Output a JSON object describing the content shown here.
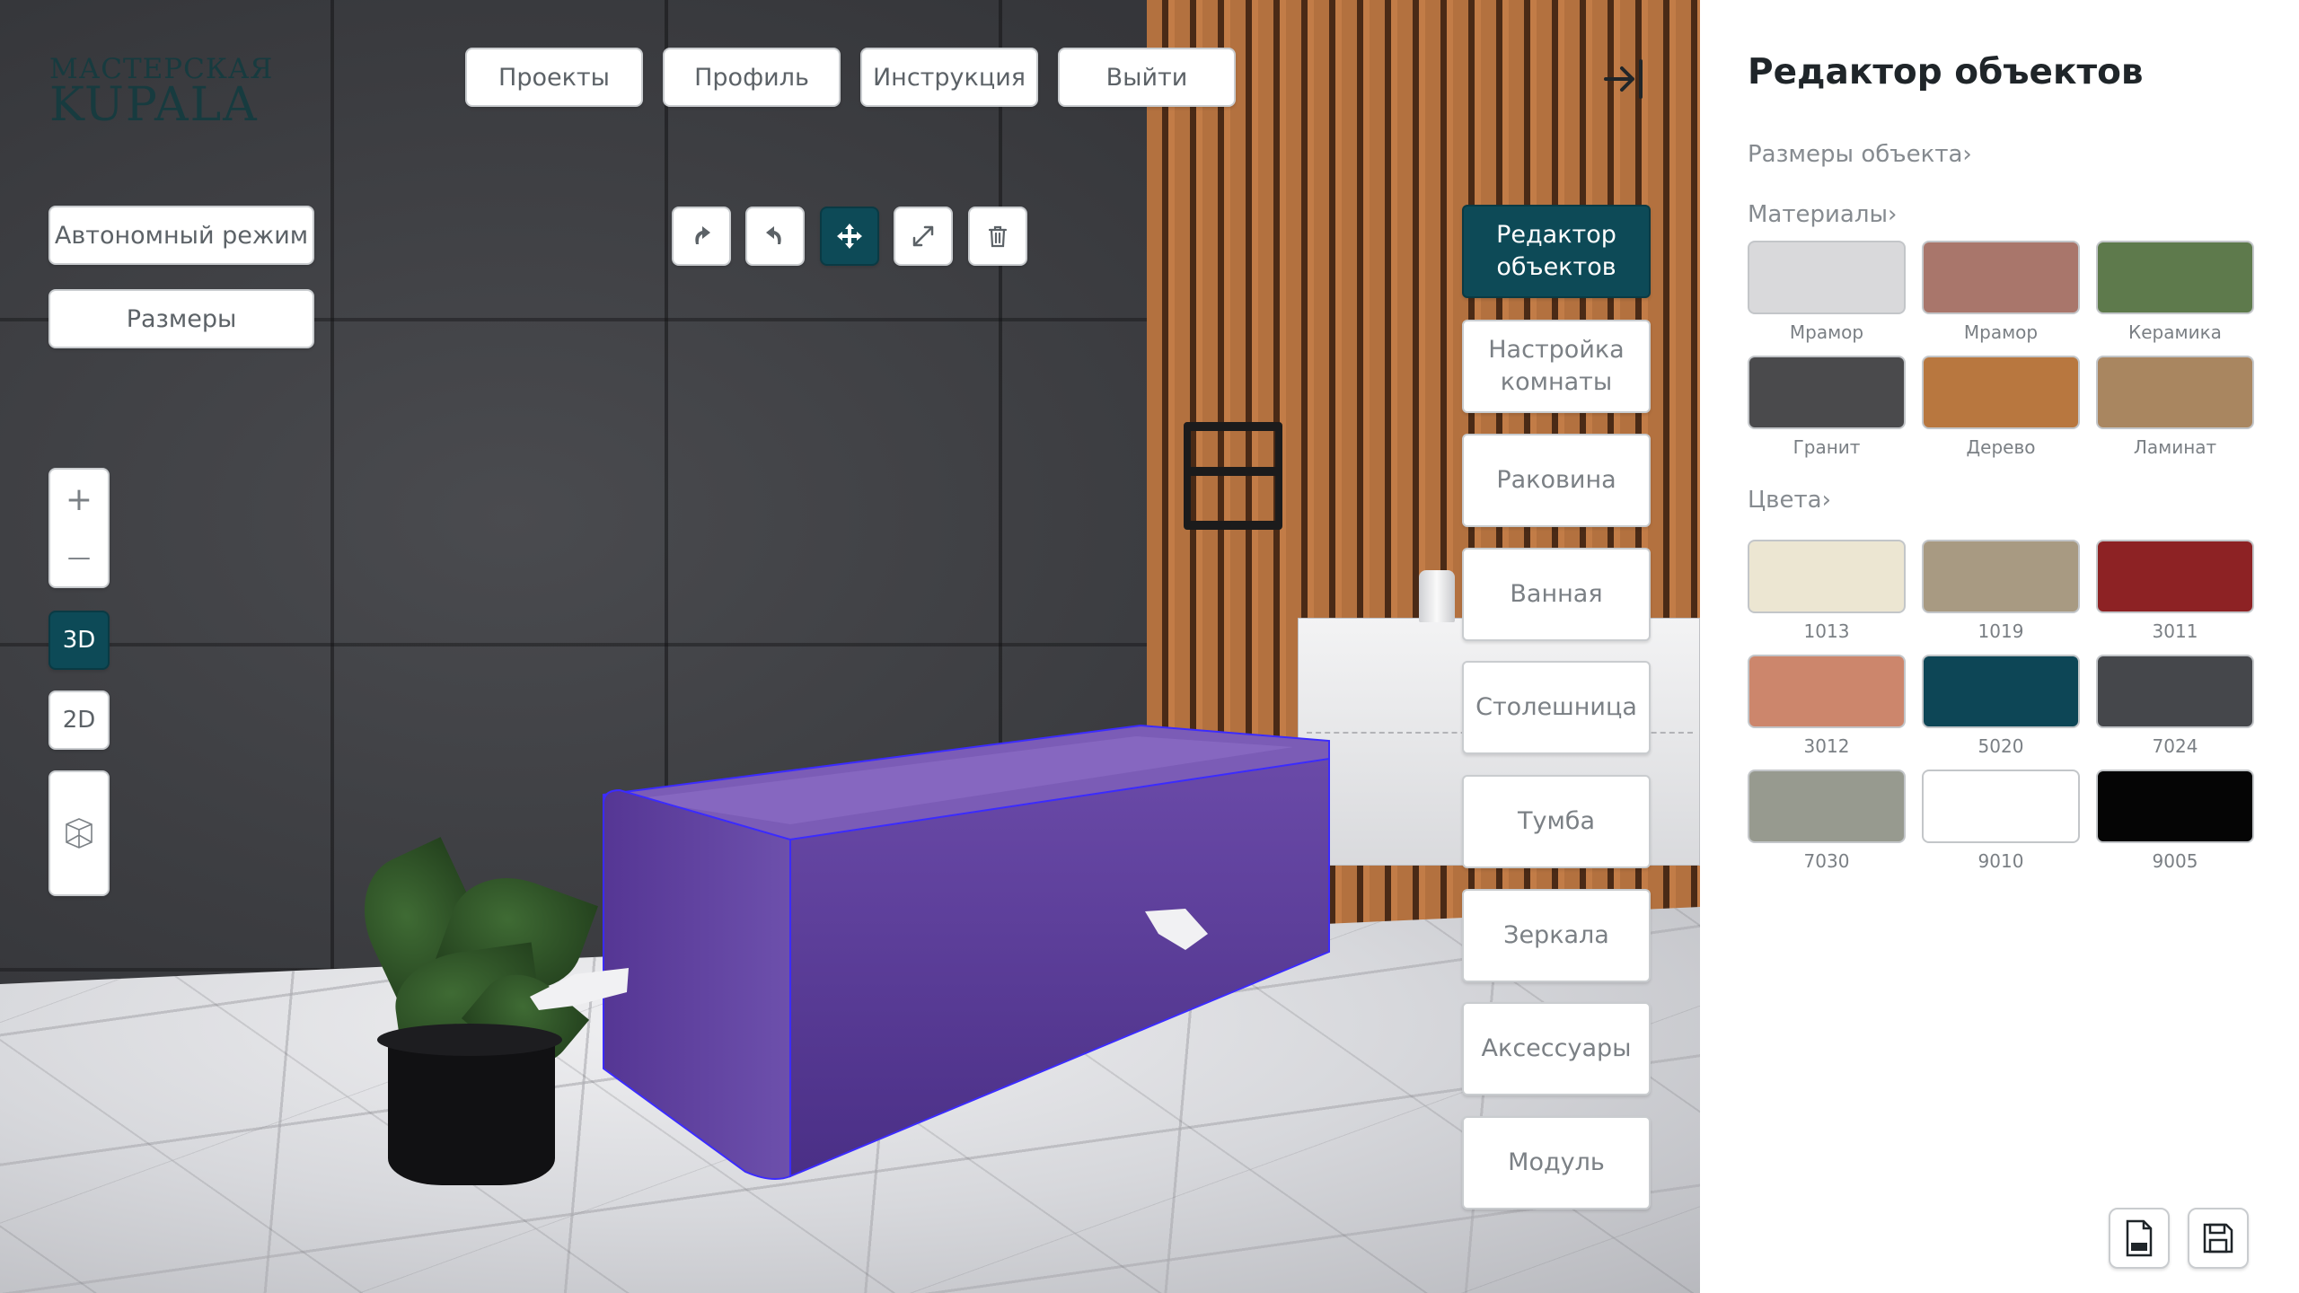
{
  "logo": {
    "line1": "МАСТЕРСКАЯ",
    "line2": "KUPALA"
  },
  "top_nav": {
    "projects": "Проекты",
    "profile": "Профиль",
    "instructions": "Инструкция",
    "logout": "Выйти"
  },
  "left_controls": {
    "autonomous_mode": "Автономный режим",
    "dimensions": "Размеры",
    "zoom_in": "+",
    "zoom_out": "—",
    "view_3d": "3D",
    "view_2d": "2D"
  },
  "toolbar": {
    "tools": [
      "rotate-cw-icon",
      "rotate-ccw-icon",
      "move-icon",
      "resize-icon",
      "trash-icon"
    ],
    "active_tool": "move-icon"
  },
  "categories": [
    {
      "label": "Редактор объектов",
      "active": true
    },
    {
      "label": "Настройка комнаты",
      "active": false
    },
    {
      "label": "Раковина",
      "active": false
    },
    {
      "label": "Ванная",
      "active": false
    },
    {
      "label": "Столешница",
      "active": false
    },
    {
      "label": "Тумба",
      "active": false
    },
    {
      "label": "Зеркала",
      "active": false
    },
    {
      "label": "Аксессуары",
      "active": false
    },
    {
      "label": "Модуль",
      "active": false
    }
  ],
  "panel": {
    "title": "Редактор объектов",
    "object_size": "Размеры объекта›",
    "materials_title": "Материалы›",
    "materials": [
      {
        "label": "Мрамор",
        "color": "#d9d9db"
      },
      {
        "label": "Мрамор",
        "color": "#a9766b"
      },
      {
        "label": "Керамика",
        "color": "#5e7a4c"
      },
      {
        "label": "Гранит",
        "color": "#4a4a4c"
      },
      {
        "label": "Дерево",
        "color": "#b8773f"
      },
      {
        "label": "Ламинат",
        "color": "#a98660"
      }
    ],
    "colors_title": "Цвета›",
    "colors": [
      {
        "label": "1013",
        "color": "#ece6d2"
      },
      {
        "label": "1019",
        "color": "#a89a82"
      },
      {
        "label": "3011",
        "color": "#8d2224"
      },
      {
        "label": "3012",
        "color": "#cc866c"
      },
      {
        "label": "5020",
        "color": "#0d4656"
      },
      {
        "label": "7024",
        "color": "#45474b"
      },
      {
        "label": "7030",
        "color": "#979a8f"
      },
      {
        "label": "9010",
        "color": "#ffffff"
      },
      {
        "label": "9005",
        "color": "#050505"
      }
    ],
    "export_pdf": "pdf-export-icon",
    "save": "save-icon"
  },
  "colors": {
    "accent": "#0d4a57",
    "selection_outline": "#3b2bff",
    "tub_fill": "#5b3a9a"
  }
}
